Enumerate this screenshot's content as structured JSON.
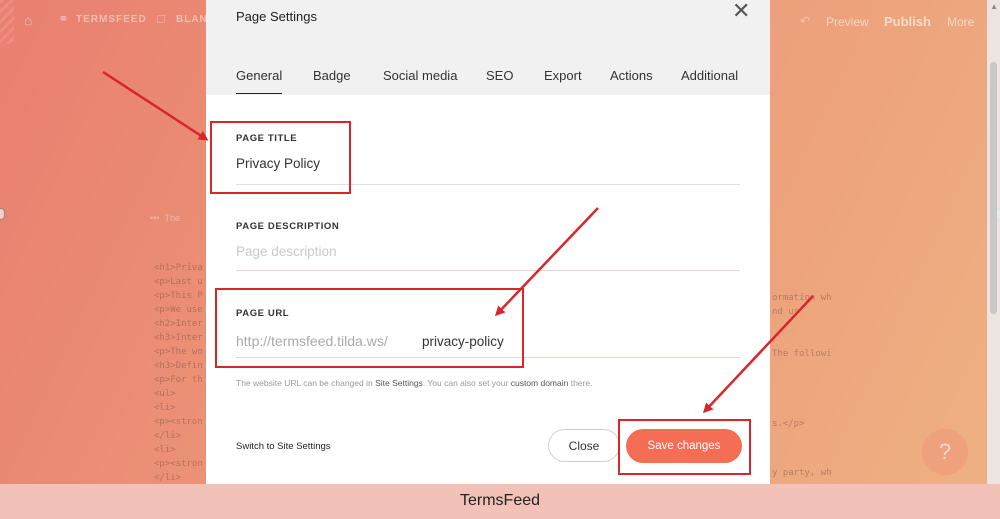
{
  "editor": {
    "site_name": "TERMSFEED",
    "page_name": "BLANK",
    "preview_label": "Preview",
    "publish_label": "Publish",
    "more_label": "More",
    "code_lines": [
      "<h1>Priva",
      "<p>Last u",
      "<p>This P",
      "<p>We use",
      "<h2>Inter",
      "<h3>Inter",
      "<p>The wo",
      "<h3>Defin",
      "<p>For th",
      "<ul>",
      "<li>",
      "<p><stron",
      "</li>",
      "<li>",
      "<p><stron",
      "</li>"
    ],
    "code_right": [
      "ormation wh",
      "nd us",
      "The followi",
      "s.</p>",
      "y party, wh"
    ]
  },
  "modal": {
    "title": "Page Settings",
    "tabs": [
      "General",
      "Badge",
      "Social media",
      "SEO",
      "Export",
      "Actions",
      "Additional"
    ],
    "active_tab": "General",
    "page_title": {
      "label": "PAGE TITLE",
      "value": "Privacy Policy"
    },
    "page_description": {
      "label": "PAGE DESCRIPTION",
      "placeholder": "Page description"
    },
    "page_url": {
      "label": "PAGE URL",
      "prefix": "http://termsfeed.tilda.ws/",
      "value": "privacy-policy"
    },
    "helper": {
      "part1": "The website URL can be changed in ",
      "link1": "Site Settings",
      "part2": ". You can also set your ",
      "link2": "custom domain",
      "part3": " there."
    },
    "switch_link": "Switch to Site Settings",
    "close_label": "Close",
    "save_label": "Save changes"
  },
  "help_glyph": "?",
  "footer": {
    "brand": "TermsFeed"
  },
  "colors": {
    "accent": "#f46d54",
    "annotation": "#d8262b"
  }
}
